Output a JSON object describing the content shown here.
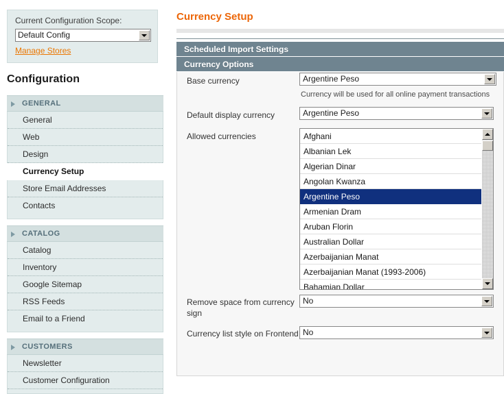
{
  "scope": {
    "label": "Current Configuration Scope:",
    "selected": "Default Config",
    "manage_stores_link": "Manage Stores"
  },
  "sidebar": {
    "title": "Configuration",
    "groups": [
      {
        "label": "GENERAL",
        "items": [
          {
            "label": "General",
            "active": false
          },
          {
            "label": "Web",
            "active": false
          },
          {
            "label": "Design",
            "active": false
          },
          {
            "label": "Currency Setup",
            "active": true
          },
          {
            "label": "Store Email Addresses",
            "active": false
          },
          {
            "label": "Contacts",
            "active": false
          }
        ]
      },
      {
        "label": "CATALOG",
        "items": [
          {
            "label": "Catalog",
            "active": false
          },
          {
            "label": "Inventory",
            "active": false
          },
          {
            "label": "Google Sitemap",
            "active": false
          },
          {
            "label": "RSS Feeds",
            "active": false
          },
          {
            "label": "Email to a Friend",
            "active": false
          }
        ]
      },
      {
        "label": "CUSTOMERS",
        "items": [
          {
            "label": "Newsletter",
            "active": false
          },
          {
            "label": "Customer Configuration",
            "active": false
          }
        ]
      }
    ]
  },
  "main": {
    "page_title": "Currency Setup",
    "sections": [
      {
        "label": "Scheduled Import Settings",
        "expanded": false
      },
      {
        "label": "Currency Options",
        "expanded": true
      }
    ],
    "fields": {
      "base_currency": {
        "label": "Base currency",
        "value": "Argentine Peso",
        "hint": "Currency will be used for all online payment transactions"
      },
      "default_display_currency": {
        "label": "Default display currency",
        "value": "Argentine Peso"
      },
      "allowed_currencies": {
        "label": "Allowed currencies",
        "options": [
          {
            "label": "Afghani",
            "selected": false
          },
          {
            "label": "Albanian Lek",
            "selected": false
          },
          {
            "label": "Algerian Dinar",
            "selected": false
          },
          {
            "label": "Angolan Kwanza",
            "selected": false
          },
          {
            "label": "Argentine Peso",
            "selected": true
          },
          {
            "label": "Armenian Dram",
            "selected": false
          },
          {
            "label": "Aruban Florin",
            "selected": false
          },
          {
            "label": "Australian Dollar",
            "selected": false
          },
          {
            "label": "Azerbaijanian Manat",
            "selected": false
          },
          {
            "label": "Azerbaijanian Manat (1993-2006)",
            "selected": false
          },
          {
            "label": "Bahamian Dollar",
            "selected": false
          }
        ]
      },
      "remove_space": {
        "label": "Remove space from currency sign",
        "value": "No"
      },
      "currency_list_style": {
        "label": "Currency list style on Frontend",
        "value": "No"
      }
    }
  },
  "colors": {
    "accent_orange": "#ec6608",
    "section_header": "#6f8490",
    "sidebar_bg": "#e3ecec",
    "selection_blue": "#10307e"
  }
}
